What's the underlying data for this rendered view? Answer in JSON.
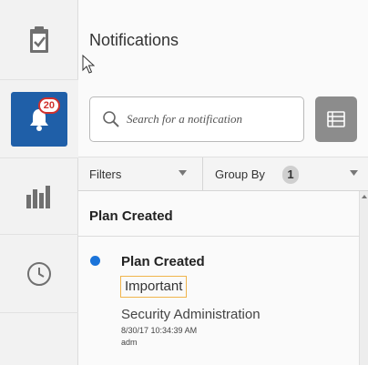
{
  "sidebar": {
    "items": [
      {
        "icon": "clipboard-check-icon"
      },
      {
        "icon": "bell-icon",
        "badge": "20",
        "active": true
      },
      {
        "icon": "bar-chart-icon"
      },
      {
        "icon": "clock-icon"
      }
    ]
  },
  "panel": {
    "title": "Notifications",
    "search": {
      "placeholder": "Search for a notification"
    },
    "filters_label": "Filters",
    "group_by_label": "Group By",
    "group_by_count": "1",
    "group_header": "Plan Created",
    "notification": {
      "title": "Plan Created",
      "tag": "Important",
      "source": "Security Administration",
      "timestamp": "8/30/17 10:34:39 AM",
      "user": "adm"
    }
  },
  "colors": {
    "accent": "#1f5fa8",
    "badge": "#d0312d",
    "unread_dot": "#1a73d9",
    "tag_border": "#f0b44c"
  }
}
